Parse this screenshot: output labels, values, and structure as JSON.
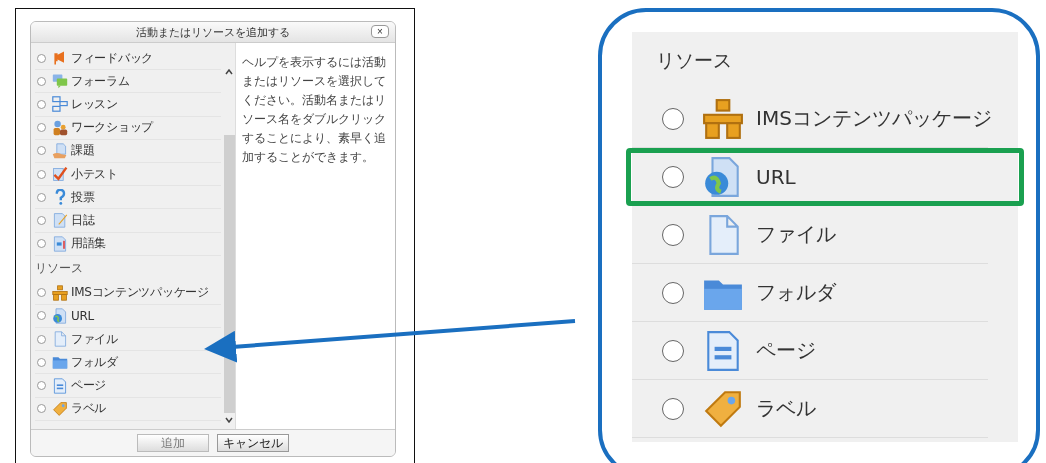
{
  "dialog": {
    "title": "活動またはリソースを追加する",
    "close": "×",
    "activities": [
      {
        "label": "フィードバック",
        "checked": false
      },
      {
        "label": "フォーラム",
        "checked": false
      },
      {
        "label": "レッスン",
        "checked": false
      },
      {
        "label": "ワークショップ",
        "checked": false
      },
      {
        "label": "課題",
        "checked": false
      },
      {
        "label": "小テスト",
        "checked": false
      },
      {
        "label": "投票",
        "checked": false
      },
      {
        "label": "日誌",
        "checked": false
      },
      {
        "label": "用語集",
        "checked": false
      }
    ],
    "resources_heading": "リソース",
    "resources": [
      {
        "label": "IMSコンテンツパッケージ",
        "checked": false
      },
      {
        "label": "URL",
        "checked": false
      },
      {
        "label": "ファイル",
        "checked": false
      },
      {
        "label": "フォルダ",
        "checked": false
      },
      {
        "label": "ページ",
        "checked": false
      },
      {
        "label": "ラベル",
        "checked": false
      }
    ],
    "help_text": "ヘルプを表示するには活動またはリソースを選択してください。活動名またはリソース名をダブルクリックすることにより、素早く追加することができます。",
    "buttons": [
      {
        "label": "追加",
        "disabled": true
      },
      {
        "label": "キャンセル",
        "disabled": false
      }
    ]
  },
  "callout": {
    "heading": "リソース",
    "items": [
      {
        "label": "IMSコンテンツパッケージ",
        "checked": false,
        "highlighted": false
      },
      {
        "label": "URL",
        "checked": false,
        "highlighted": true
      },
      {
        "label": "ファイル",
        "checked": false,
        "highlighted": false
      },
      {
        "label": "フォルダ",
        "checked": false,
        "highlighted": false
      },
      {
        "label": "ページ",
        "checked": false,
        "highlighted": false
      },
      {
        "label": "ラベル",
        "checked": false,
        "highlighted": false
      }
    ]
  }
}
